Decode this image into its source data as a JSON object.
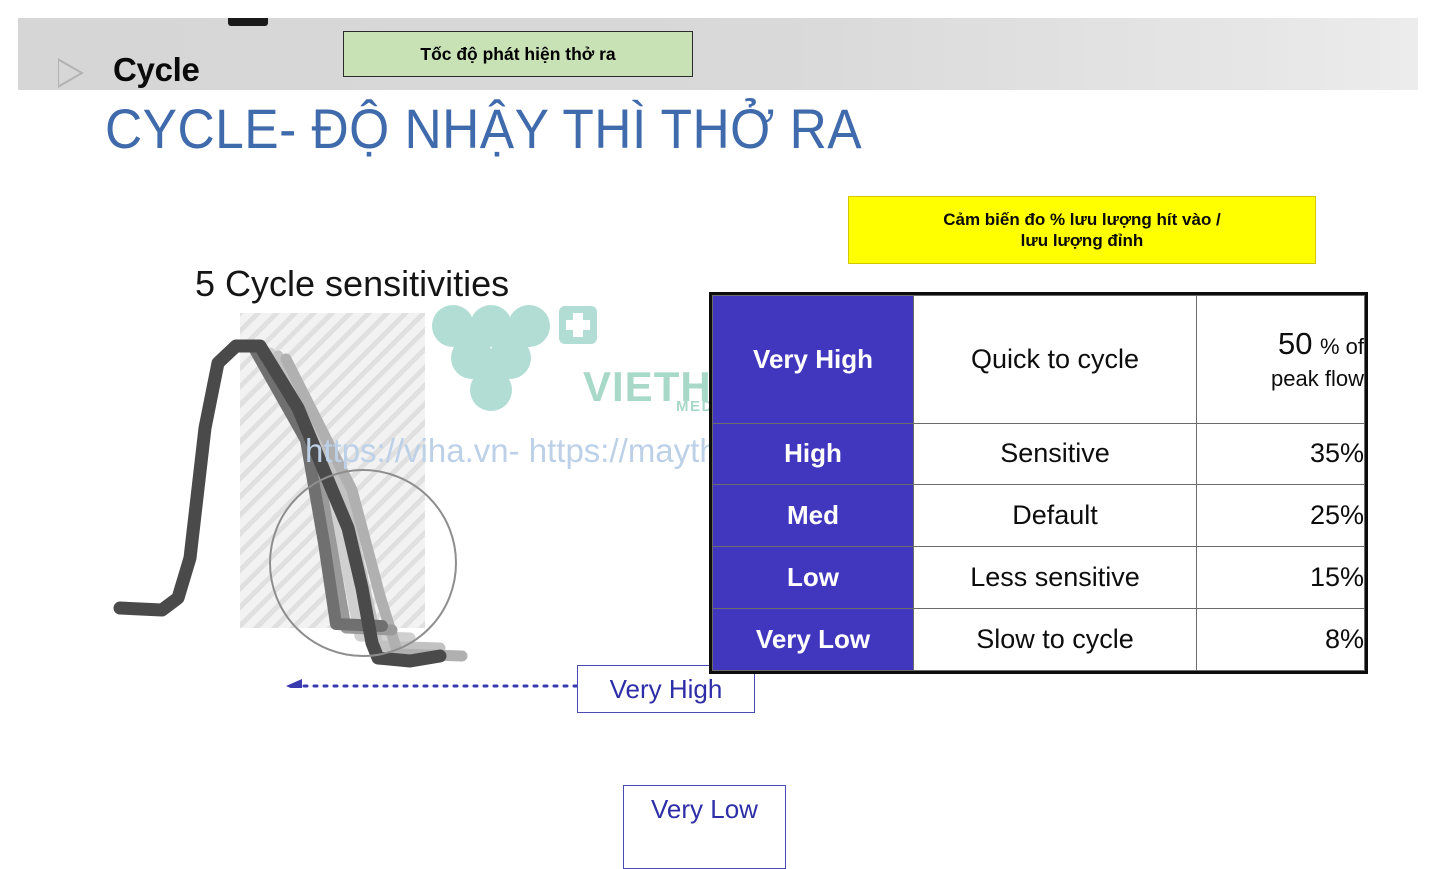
{
  "header": {
    "section_label": "Cycle",
    "bullet_icon": "triangle-right-icon",
    "green_note": "Tốc độ phát hiện thở ra"
  },
  "slide": {
    "title": "CYCLE- ĐỘ NHẬY THÌ THỞ RA",
    "title_color": "#3f6aab"
  },
  "yellow_note": {
    "line1": "Cảm biến đo % lưu lượng hít vào /",
    "line2": "lưu lượng đỉnh",
    "background": "#ffff00"
  },
  "graphic": {
    "title": "5 Cycle sensitivities",
    "callouts": [
      {
        "label": "Very High",
        "name": "callout-very-high"
      },
      {
        "label": "Very Low",
        "name": "callout-very-low"
      }
    ]
  },
  "watermark": {
    "url": "https://viha.vn- https://maytho.com.vn",
    "brand": "VIETHA",
    "brand_sub": "MEDICAL",
    "brand_color": "#a8d8c8"
  },
  "table": {
    "level_bg": "#4137bf",
    "rows": [
      {
        "level": "Very High",
        "description": "Quick to cycle",
        "percent": "50",
        "percent_suffix": "% of",
        "percent_line2": "peak flow"
      },
      {
        "level": "High",
        "description": "Sensitive",
        "percent": "35%"
      },
      {
        "level": "Med",
        "description": "Default",
        "percent": "25%"
      },
      {
        "level": "Low",
        "description": "Less sensitive",
        "percent": "15%"
      },
      {
        "level": "Very Low",
        "description": "Slow to cycle",
        "percent": "8%"
      }
    ]
  }
}
